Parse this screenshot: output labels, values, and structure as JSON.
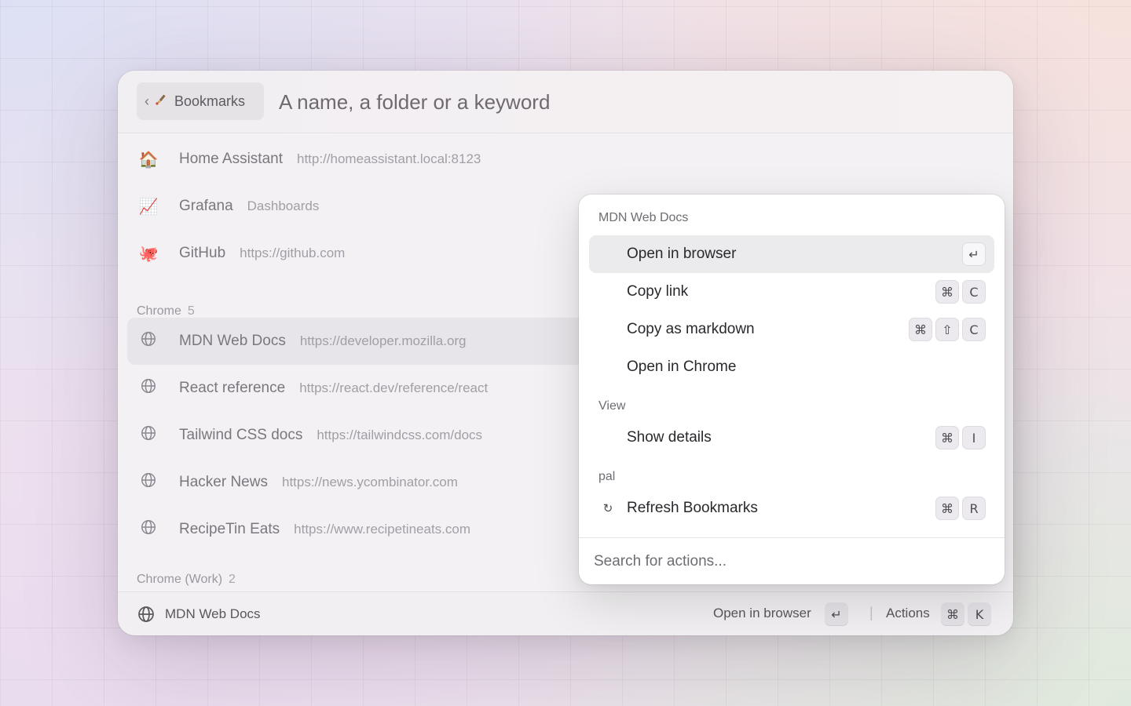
{
  "header": {
    "back_label": "Bookmarks",
    "back_chevron": "‹",
    "bookmark_icon": "bookmark-brush-icon",
    "search_placeholder": "A name, a folder or a keyword"
  },
  "list": {
    "pinned": [
      {
        "icon": "🏠",
        "icon_name": "house-icon",
        "title": "Home Assistant",
        "subtitle": "http://homeassistant.local:8123"
      },
      {
        "icon": "📈",
        "icon_name": "chart-icon",
        "title": "Grafana",
        "subtitle": "Dashboards"
      },
      {
        "icon": "🐙",
        "icon_name": "octopus-icon",
        "title": "GitHub",
        "subtitle": "https://github.com"
      }
    ],
    "chrome_section": {
      "title": "Chrome",
      "count": "5"
    },
    "chrome": [
      {
        "icon_name": "globe-icon",
        "title": "MDN Web Docs",
        "subtitle": "https://developer.mozilla.org"
      },
      {
        "icon_name": "globe-icon",
        "title": "React reference",
        "subtitle": "https://react.dev/reference/react"
      },
      {
        "icon_name": "globe-icon",
        "title": "Tailwind CSS docs",
        "subtitle": "https://tailwindcss.com/docs"
      },
      {
        "icon_name": "globe-icon",
        "title": "Hacker News",
        "subtitle": "https://news.ycombinator.com"
      },
      {
        "icon_name": "globe-icon",
        "title": "RecipeTin Eats",
        "subtitle": "https://www.recipetineats.com"
      }
    ],
    "chrome_work_section": {
      "title": "Chrome (Work)",
      "count": "2"
    }
  },
  "actions_popover": {
    "section_main": "MDN Web Docs",
    "items_main": [
      {
        "label": "Open in browser",
        "keys": [
          "↵"
        ]
      },
      {
        "label": "Copy link",
        "keys": [
          "⌘",
          "C"
        ]
      },
      {
        "label": "Copy as markdown",
        "keys": [
          "⌘",
          "⇧",
          "C"
        ]
      },
      {
        "label": "Open in Chrome",
        "keys": []
      }
    ],
    "section_view": "View",
    "items_view": [
      {
        "label": "Show details",
        "keys": [
          "⌘",
          "I"
        ]
      }
    ],
    "section_pal": "pal",
    "items_pal": [
      {
        "icon": "↻",
        "icon_name": "refresh-icon",
        "label": "Refresh Bookmarks",
        "keys": [
          "⌘",
          "R"
        ]
      }
    ],
    "search_placeholder": "Search for actions..."
  },
  "footer": {
    "selected_title": "MDN Web Docs",
    "primary_action": "Open in browser",
    "primary_key": "↵",
    "separator": "|",
    "actions_label": "Actions",
    "actions_keys": [
      "⌘",
      "K"
    ]
  }
}
